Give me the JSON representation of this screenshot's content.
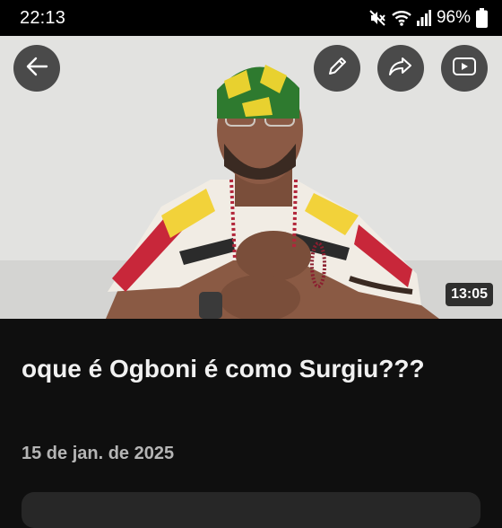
{
  "status_bar": {
    "time": "22:13",
    "battery": "96%",
    "icons": [
      "mute-icon",
      "wifi-icon",
      "signal-icon",
      "battery-icon"
    ]
  },
  "video": {
    "duration": "13:05",
    "buttons": [
      "back-arrow-icon",
      "edit-pencil-icon",
      "share-icon",
      "play-icon"
    ]
  },
  "title": "oque é Ogboni é como Surgiu???",
  "date": "15 de jan. de 2025",
  "colors": {
    "background": "#0f0f0f",
    "overlay_button": "#282828",
    "date_text": "#b5b5b5"
  }
}
